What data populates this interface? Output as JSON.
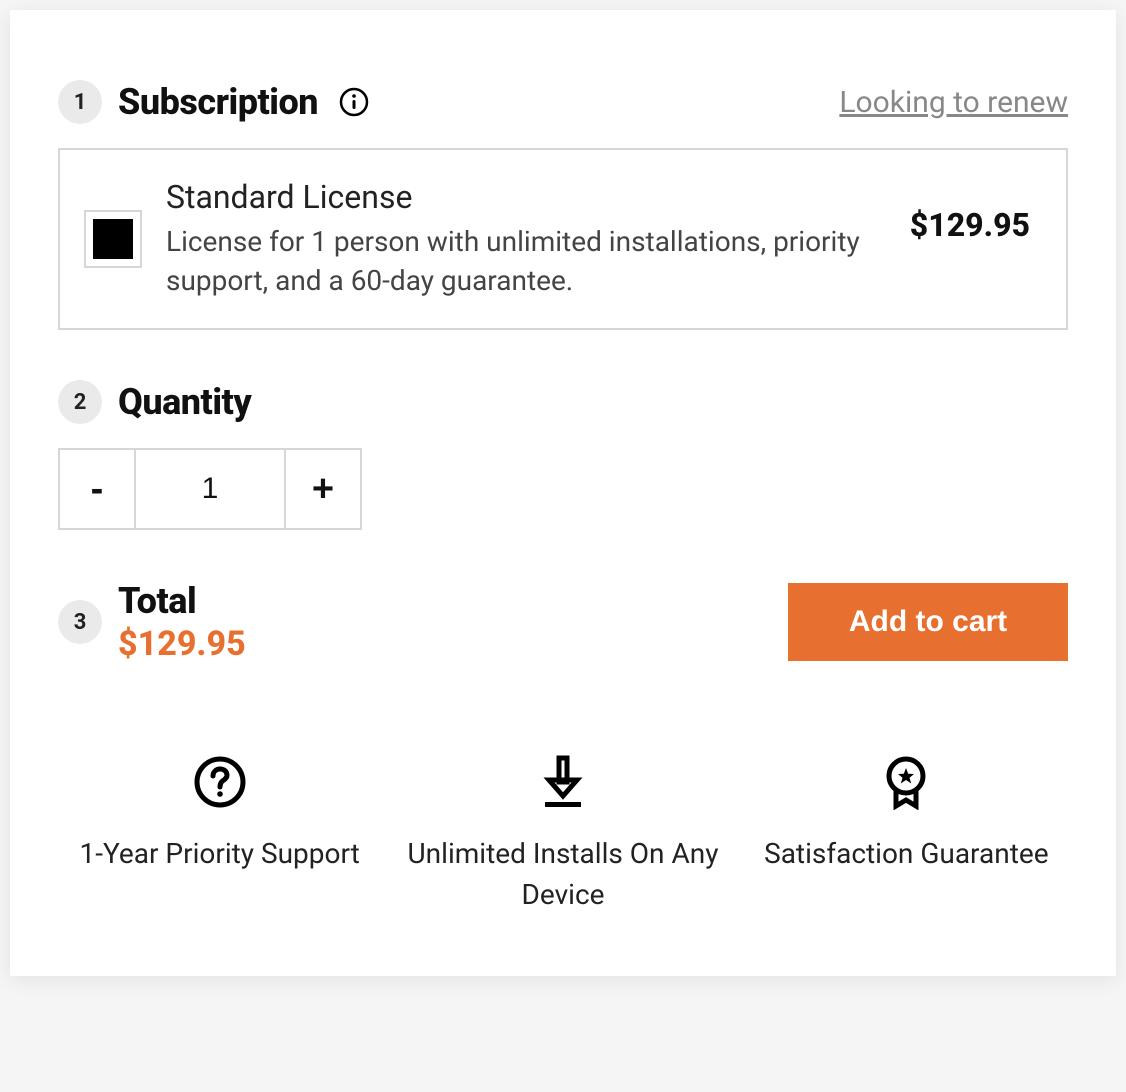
{
  "subscription": {
    "step": "1",
    "title": "Subscription",
    "renew_link": "Looking to renew",
    "license": {
      "name": "Standard License",
      "description": "License for 1 person with unlimited installations, priority support, and a 60-day guarantee.",
      "price": "$129.95"
    }
  },
  "quantity": {
    "step": "2",
    "title": "Quantity",
    "value": "1",
    "minus": "-",
    "plus": "+"
  },
  "total": {
    "step": "3",
    "title": "Total",
    "price": "$129.95",
    "button": "Add to cart"
  },
  "benefits": [
    {
      "text": "1-Year Priority Support"
    },
    {
      "text": "Unlimited Installs On Any Device"
    },
    {
      "text": "Satisfaction Guarantee"
    }
  ]
}
